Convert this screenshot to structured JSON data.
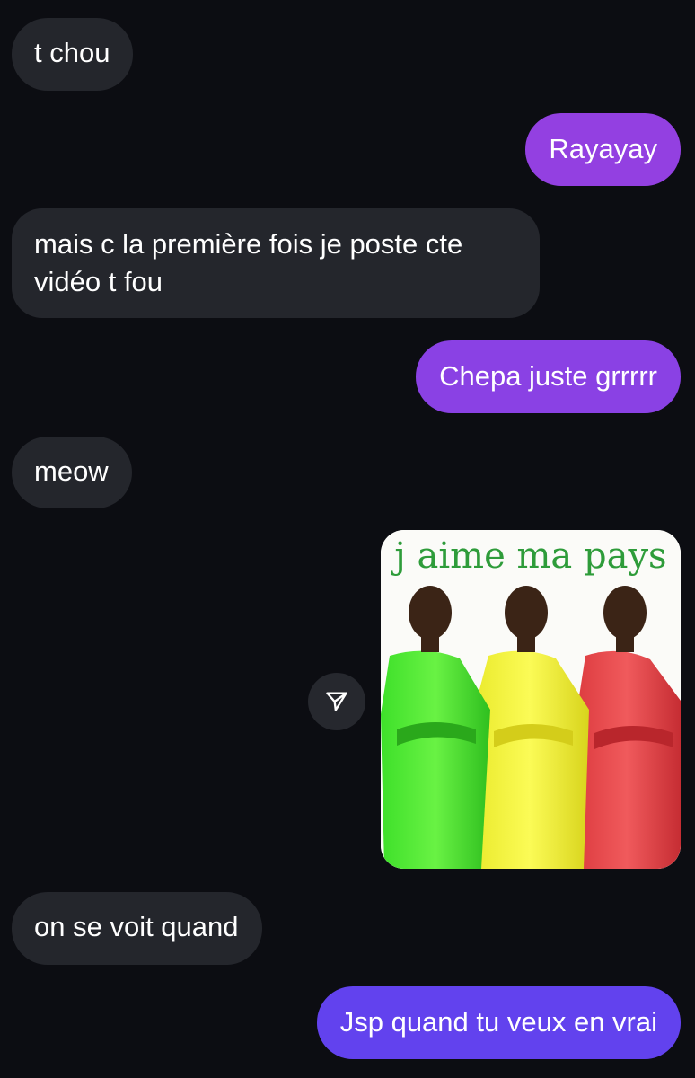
{
  "colors": {
    "background": "#0c0d12",
    "incoming_bubble": "#24262c",
    "outgoing_gradient_top": "#8e3fe0",
    "outgoing_gradient_bottom": "#5d44ed",
    "text": "#ffffff"
  },
  "messages": [
    {
      "direction": "incoming",
      "text": "t chou"
    },
    {
      "direction": "outgoing",
      "text": "Rayayay",
      "color": "#9340e1"
    },
    {
      "direction": "incoming",
      "text": "mais c la première fois je poste cte vidéo t fou"
    },
    {
      "direction": "outgoing",
      "text": "Chepa juste grrrrr",
      "color": "#8a41e4"
    },
    {
      "direction": "incoming",
      "text": "meow"
    },
    {
      "direction": "outgoing",
      "type": "image",
      "image_caption": "j aime ma pays",
      "share_icon": "send-arrow-icon",
      "figures": [
        "green",
        "yellow",
        "red"
      ]
    },
    {
      "direction": "incoming",
      "text": "on se voit quand"
    },
    {
      "direction": "outgoing",
      "text": "Jsp quand tu veux en vrai",
      "color": "#6242ee"
    }
  ]
}
